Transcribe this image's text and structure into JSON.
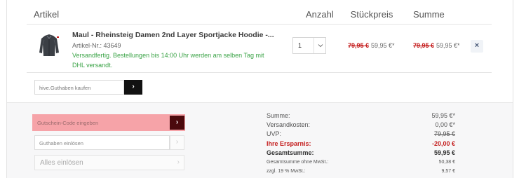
{
  "table_header": {
    "article": "Artikel",
    "quantity": "Anzahl",
    "unit_price": "Stückpreis",
    "total": "Summe"
  },
  "product": {
    "title": "Maul - Rheinsteig Damen 2nd Layer Sportjacke Hoodie -...",
    "article_number": "Artikel-Nr.: 43649",
    "shipping_note": "Versandfertig. Bestellungen bis 14:00 Uhr werden am selben Tag mit DHL versandt.",
    "quantity": "1",
    "unit_price_old": "79,95 €",
    "unit_price_new": "59,95 €*",
    "total_price_old": "79,95 €",
    "total_price_new": "59,95 €*",
    "remove_label": "×"
  },
  "gift_card": {
    "placeholder": "hive.Guthaben kaufen",
    "button_label": "›"
  },
  "voucher": {
    "placeholder": "Gutschein-Code eingeben",
    "button_label": "›"
  },
  "credit": {
    "placeholder": "Guthaben einlösen",
    "button_label": "›"
  },
  "redeem_all": {
    "label": "Alles einlösen",
    "arrow": "›"
  },
  "summary": {
    "subtotal_label": "Summe:",
    "subtotal_value": "59,95 €*",
    "shipping_label": "Versandkosten:",
    "shipping_value": "0,00 €*",
    "rrp_label": "UVP:",
    "rrp_value": "79,95 €",
    "savings_label": "Ihre Ersparnis:",
    "savings_value": "-20,00 €",
    "grand_total_label": "Gesamtsumme:",
    "grand_total_value": "59,95 €",
    "net_label": "Gesamtsumme ohne MwSt.:",
    "net_value": "50,38 €",
    "vat_label": "zzgl. 19 % MwSt.:",
    "vat_value": "9,57 €"
  },
  "colors": {
    "accent_dark": "#4b0a0d",
    "highlight": "#f6a3a8",
    "sale_red": "#c41d1d",
    "shipping_green": "#3aa346"
  }
}
